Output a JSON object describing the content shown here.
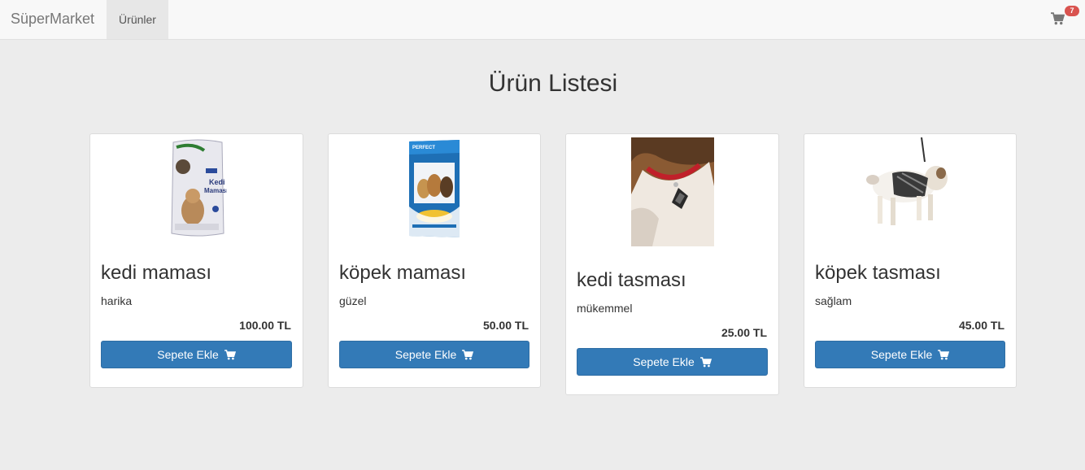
{
  "navbar": {
    "brand": "SüperMarket",
    "nav_item": "Ürünler",
    "cart_count": "7"
  },
  "page_title": "Ürün Listesi",
  "products": [
    {
      "name": "kedi maması",
      "description": "harika",
      "price": "100.00 TL",
      "button_label": "Sepete Ekle"
    },
    {
      "name": "köpek maması",
      "description": "güzel",
      "price": "50.00 TL",
      "button_label": "Sepete Ekle"
    },
    {
      "name": "kedi tasması",
      "description": "mükemmel",
      "price": "25.00 TL",
      "button_label": "Sepete Ekle"
    },
    {
      "name": "köpek tasması",
      "description": "sağlam",
      "price": "45.00 TL",
      "button_label": "Sepete Ekle"
    }
  ],
  "colors": {
    "primary": "#337ab7",
    "badge": "#d9534f",
    "navbar_bg": "#f8f8f8",
    "page_bg": "#ececec"
  },
  "icons": {
    "cart": "shopping-cart-icon"
  }
}
